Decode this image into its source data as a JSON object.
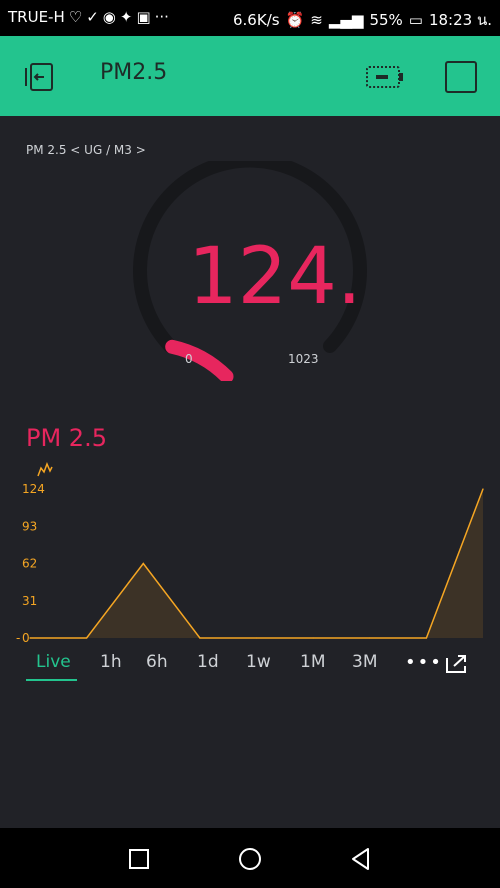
{
  "status_bar": {
    "carrier": "TRUE-H",
    "speed": "6.6K/s",
    "battery": "55%",
    "time": "18:23 น."
  },
  "header": {
    "title": "PM2.5"
  },
  "gauge": {
    "label": "PM 2.5 < UG / M3 >",
    "value": "124.",
    "min": "0",
    "max": "1023",
    "level": 0.121,
    "color": "#e7265e"
  },
  "chart": {
    "title": "PM 2.5",
    "y_ticks": [
      "124",
      "93",
      "62",
      "31",
      "0"
    ],
    "accent": "#f5a623"
  },
  "chart_data": {
    "type": "line",
    "title": "PM 2.5",
    "xlabel": "",
    "ylabel": "",
    "ylim": [
      0,
      124
    ],
    "x": [
      0,
      1,
      2,
      3,
      4,
      5,
      6,
      7,
      8
    ],
    "series": [
      {
        "name": "PM 2.5",
        "values": [
          0,
          0,
          62,
          0,
          0,
          0,
          0,
          0,
          124
        ]
      }
    ]
  },
  "tabs": [
    {
      "label": "Live",
      "active": true
    },
    {
      "label": "1h",
      "active": false
    },
    {
      "label": "6h",
      "active": false
    },
    {
      "label": "1d",
      "active": false
    },
    {
      "label": "1w",
      "active": false
    },
    {
      "label": "1M",
      "active": false
    },
    {
      "label": "3M",
      "active": false
    }
  ],
  "more_label": "•••"
}
